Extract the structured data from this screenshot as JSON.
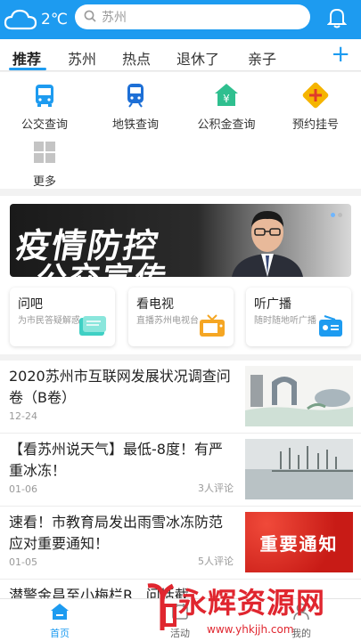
{
  "header": {
    "temperature": "2℃",
    "search_text": "苏州"
  },
  "tabs": [
    "推荐",
    "苏州",
    "热点",
    "退休了",
    "亲子"
  ],
  "services": [
    {
      "label": "公交查询",
      "icon": "bus-icon",
      "color": "#1d9bf0"
    },
    {
      "label": "地铁查询",
      "icon": "metro-icon",
      "color": "#1d6fd6"
    },
    {
      "label": "公积金查询",
      "icon": "fund-icon",
      "color": "#2fbf8f"
    },
    {
      "label": "预约挂号",
      "icon": "medical-plus-icon",
      "color": "#f5b400"
    },
    {
      "label": "更多",
      "icon": "more-grid-icon",
      "color": "#bfbfbf"
    }
  ],
  "banner": {
    "line1": "疫情防控",
    "line2": "公交宣传"
  },
  "cards": [
    {
      "title": "问吧",
      "sub": "为市民答疑解惑",
      "icon": "book-icon",
      "color": "#3fd0c4"
    },
    {
      "title": "看电视",
      "sub": "直播苏州电视台",
      "icon": "tv-icon",
      "color": "#f5a623"
    },
    {
      "title": "听广播",
      "sub": "随时随地听广播",
      "icon": "radio-icon",
      "color": "#1d9bf0"
    }
  ],
  "news": [
    {
      "title": "2020苏州市互联网发展状况调查问卷（B卷）",
      "date": "12-24",
      "comments": ""
    },
    {
      "title": "【看苏州说天气】最低-8度！有严重冰冻！",
      "date": "01-06",
      "comments": "3人评论"
    },
    {
      "title": "速看！市教育局发出雨雪冰冻防范应对重要通知！",
      "date": "01-05",
      "comments": "5人评论",
      "thumb_text": "重要通知"
    },
    {
      "title": "潜警金昌至小梅栏R...问括截",
      "date": "",
      "comments": ""
    }
  ],
  "bottom_nav": [
    {
      "label": "首页"
    },
    {
      "label": "活动"
    },
    {
      "label": "我的"
    }
  ],
  "watermark": {
    "text": "永辉资源网",
    "url": "www.yhkjjh.com"
  },
  "colors": {
    "accent": "#1d9bf0",
    "watermark": "#e0262f"
  }
}
